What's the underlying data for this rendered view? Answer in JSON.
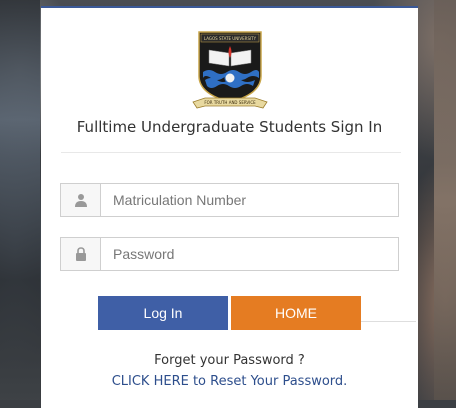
{
  "header": {
    "title": "Fulltime Undergraduate Students Sign In",
    "logo_motto": "FOR TRUTH AND SERVICE",
    "logo_name": "LAGOS STATE UNIVERSITY"
  },
  "form": {
    "matric_placeholder": "Matriculation Number",
    "matric_value": "",
    "password_placeholder": "Password",
    "password_value": "",
    "user_icon": "user-icon",
    "lock_icon": "lock-icon"
  },
  "buttons": {
    "login_label": "Log In",
    "home_label": "HOME"
  },
  "footer": {
    "forgot_text": "Forget your Password ?",
    "reset_link": "CLICK HERE to Reset Your Password."
  },
  "colors": {
    "login": "#3f5fa6",
    "home": "#e57c22",
    "link": "#2d4e8c"
  }
}
